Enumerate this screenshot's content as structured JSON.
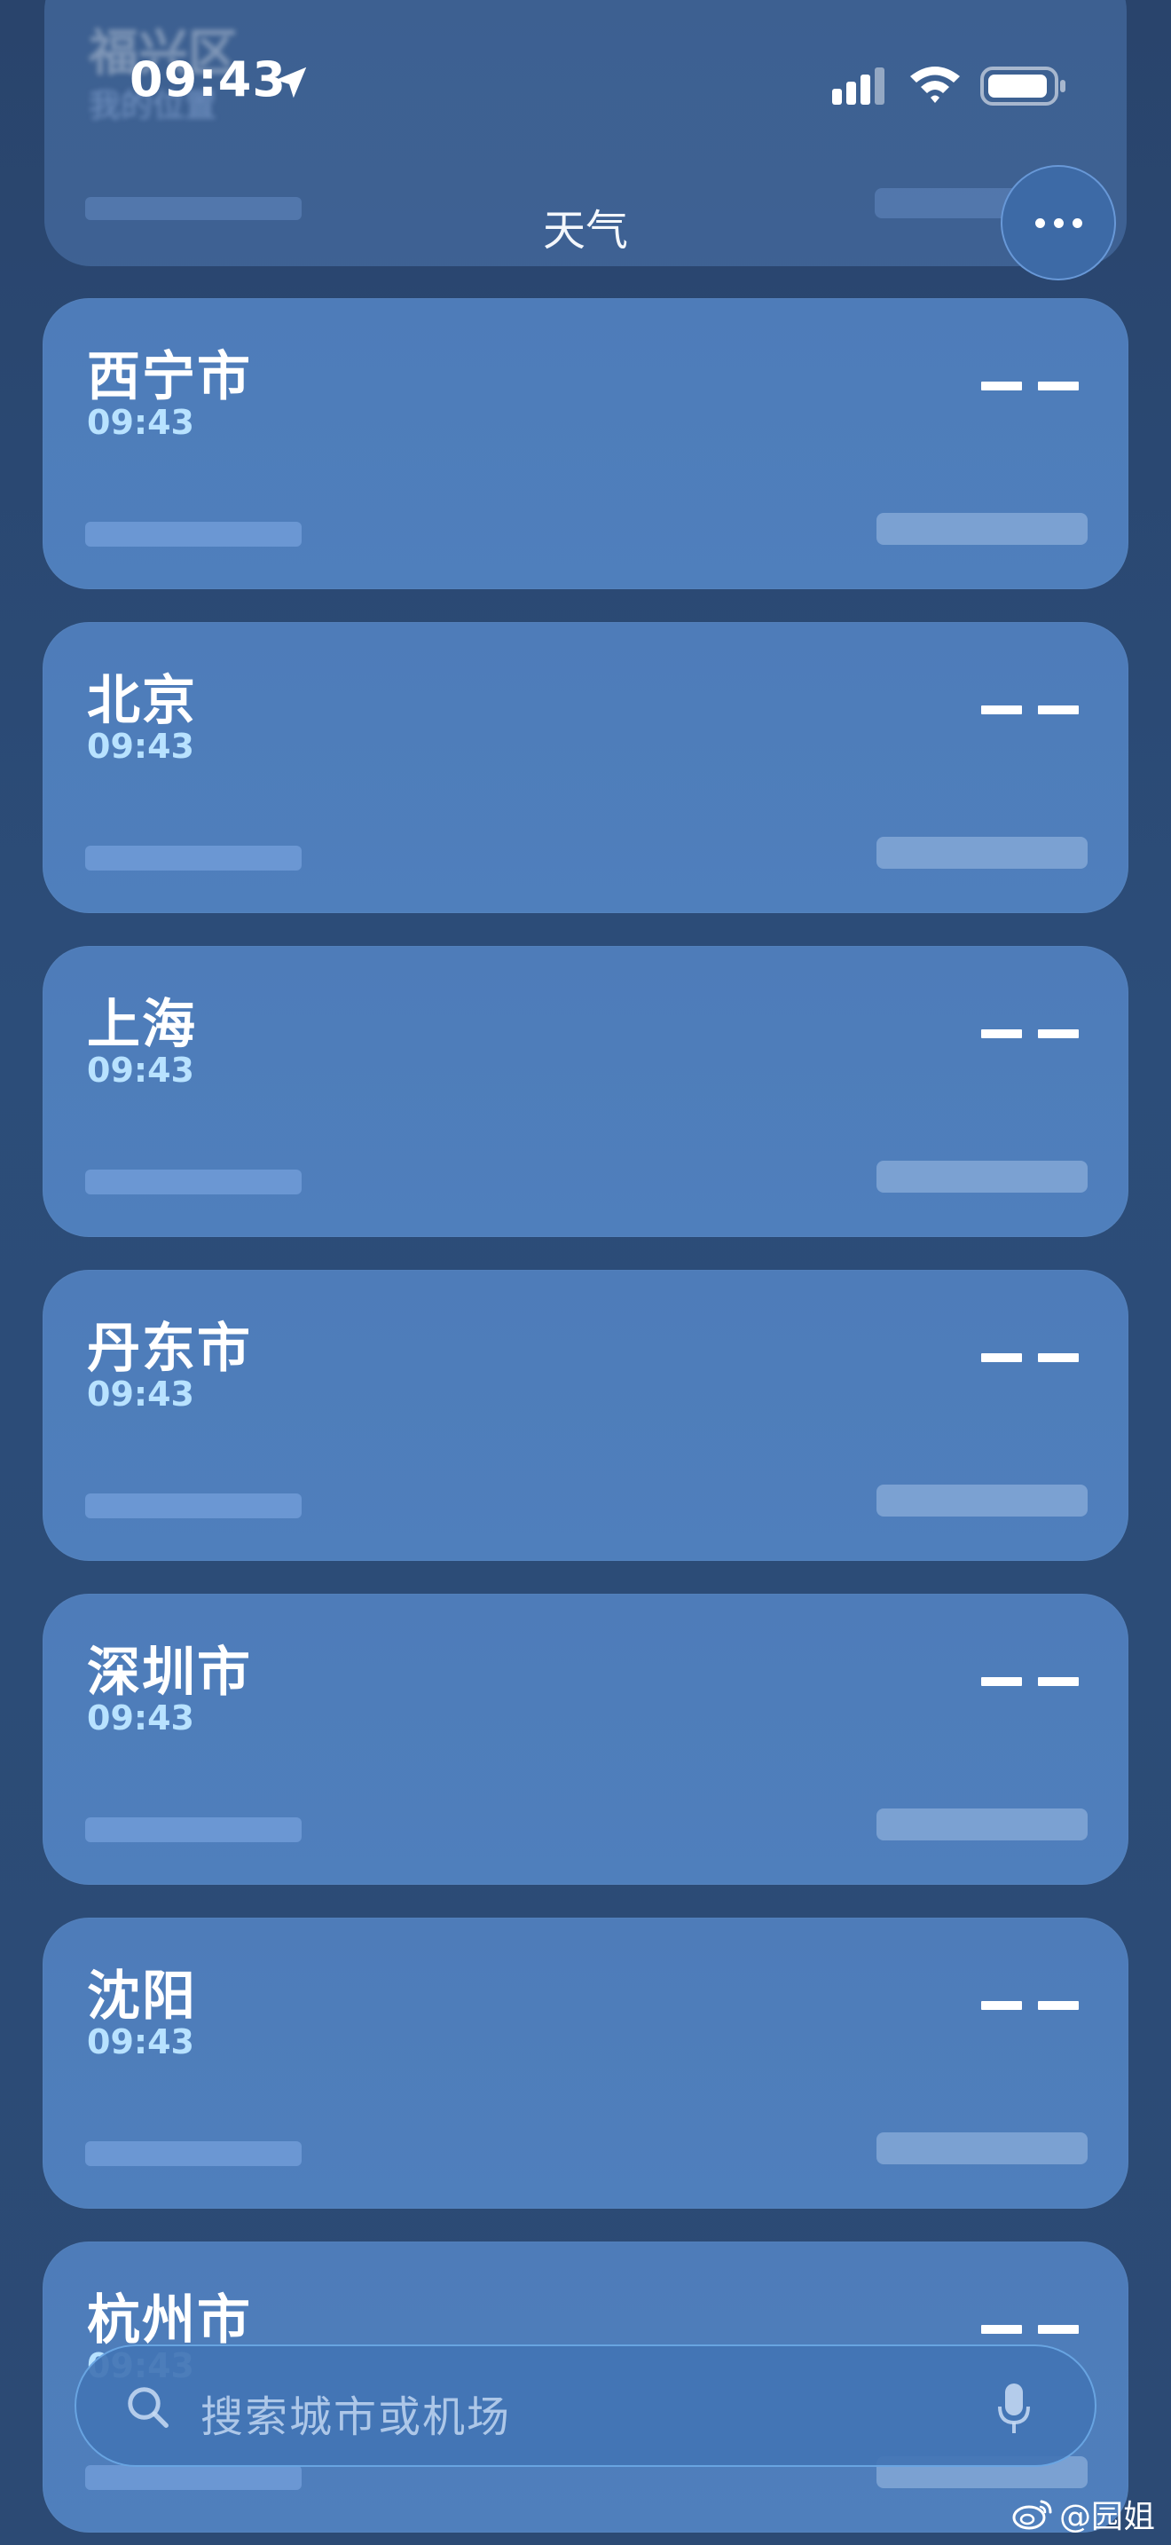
{
  "status_bar": {
    "time": "09:43",
    "location_icon": "location-arrow-icon",
    "signal_icon": "cellular-signal-icon",
    "wifi_icon": "wifi-icon",
    "battery_icon": "battery-icon"
  },
  "header": {
    "title": "天气",
    "more_icon": "ellipsis-icon"
  },
  "top_card": {
    "name": "福兴区",
    "subtitle": "我的位置"
  },
  "cities": [
    {
      "name": "西宁市",
      "time": "09:43",
      "temp": "——"
    },
    {
      "name": "北京",
      "time": "09:43",
      "temp": "——"
    },
    {
      "name": "上海",
      "time": "09:43",
      "temp": "——"
    },
    {
      "name": "丹东市",
      "time": "09:43",
      "temp": "——"
    },
    {
      "name": "深圳市",
      "time": "09:43",
      "temp": "——"
    },
    {
      "name": "沈阳",
      "time": "09:43",
      "temp": "——"
    },
    {
      "name": "杭州市",
      "time": "09:43",
      "temp": "——"
    }
  ],
  "search": {
    "placeholder": "搜索城市或机场",
    "search_icon": "search-icon",
    "mic_icon": "microphone-icon"
  },
  "watermark": {
    "text": "@园姐",
    "icon": "weibo-icon"
  },
  "colors": {
    "background": "#2b4a76",
    "card": "#4e7cb9",
    "time_accent": "#b8e2ff",
    "button": "#3d6aa6"
  }
}
